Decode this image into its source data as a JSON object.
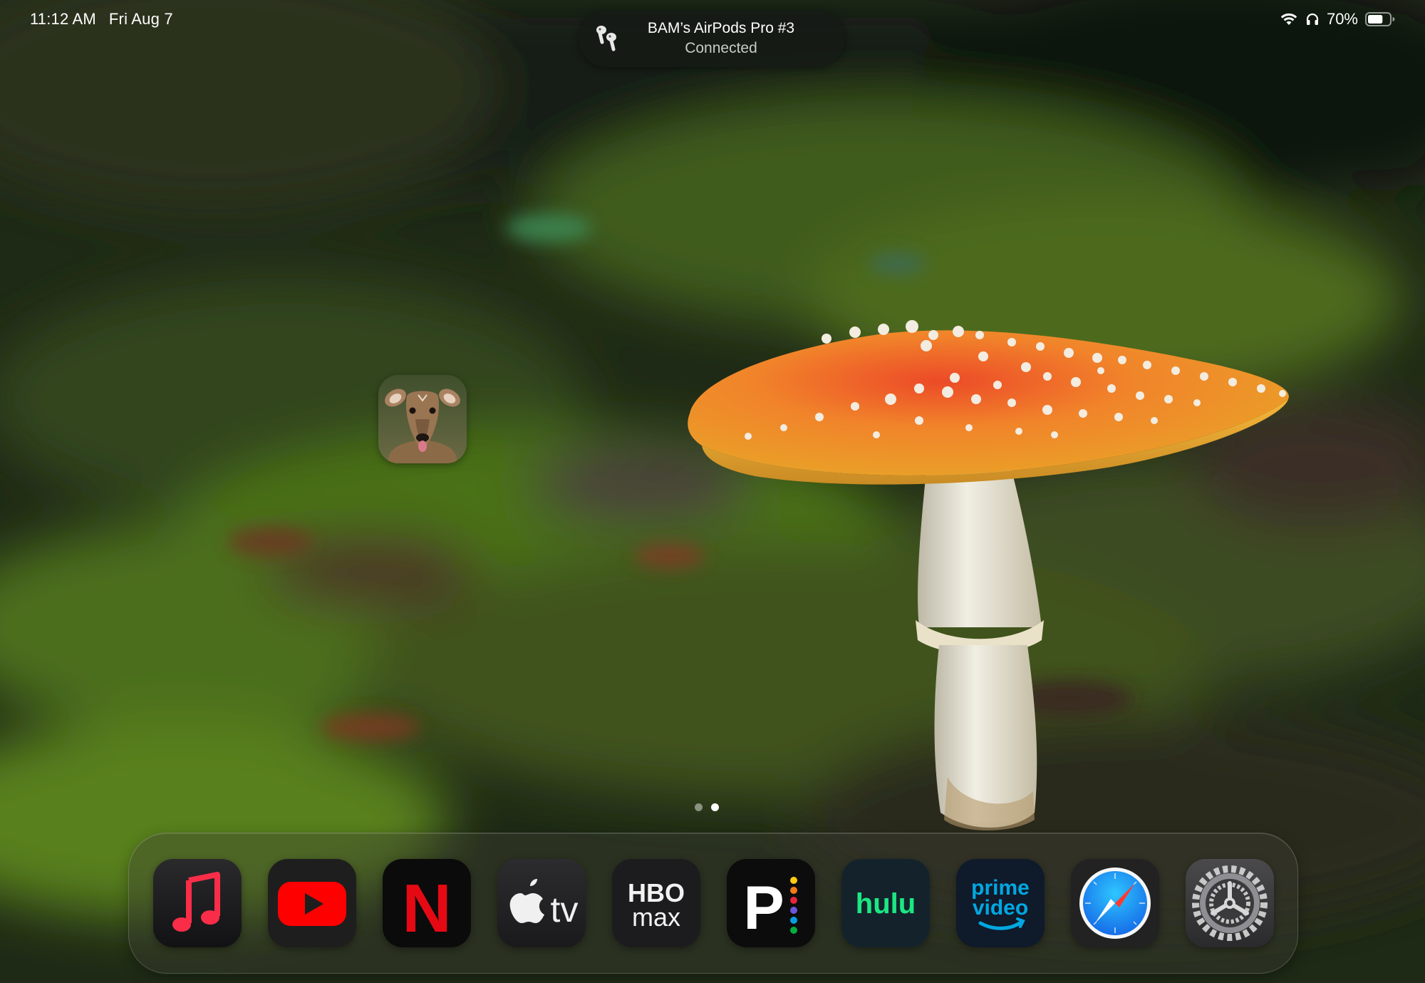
{
  "status_bar": {
    "time": "11:12 AM",
    "date": "Fri Aug 7",
    "battery_percent": "70%",
    "battery_level": 0.7
  },
  "notification": {
    "title": "BAM’s AirPods Pro #3",
    "subtitle": "Connected"
  },
  "home_screen": {
    "apps": [
      {
        "name": "deer-app",
        "icon": "deer-photo-icon"
      }
    ],
    "page_count": 2,
    "current_page": 2
  },
  "dock": {
    "apps": [
      {
        "icon": "music-icon"
      },
      {
        "icon": "youtube-icon"
      },
      {
        "icon": "netflix-icon",
        "label": "N"
      },
      {
        "icon": "apple-tv-icon",
        "label": "tv"
      },
      {
        "icon": "hbo-max-icon",
        "label_top": "HBO",
        "label_bottom": "max"
      },
      {
        "icon": "peacock-icon",
        "label": "P"
      },
      {
        "icon": "hulu-icon",
        "label": "hulu"
      },
      {
        "icon": "prime-video-icon",
        "label_top": "prime",
        "label_bottom": "video"
      },
      {
        "icon": "safari-icon"
      },
      {
        "icon": "settings-icon"
      }
    ]
  },
  "colors": {
    "hulu_green": "#1ce783",
    "netflix_red": "#e50914",
    "youtube_red": "#ff0000",
    "prime_blue": "#00a8e1",
    "mushroom_orange": "#f08a1e"
  }
}
